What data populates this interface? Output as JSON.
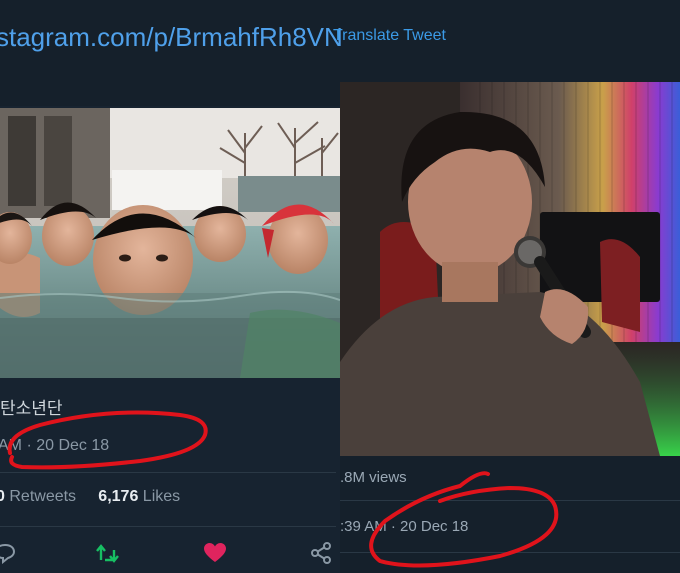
{
  "header": {
    "link_text": "stagram.com/p/BrmahfRh8VN",
    "translate_label": "Translate Tweet"
  },
  "left_tweet": {
    "caption": "탄소년단",
    "timestamp": "AM · 20 Dec 18",
    "retweets_count": "0",
    "retweets_label": "Retweets",
    "likes_count": "6,176",
    "likes_label": "Likes"
  },
  "right_tweet": {
    "views": ".8M views",
    "timestamp": ":39 AM · 20 Dec 18"
  },
  "icons": [
    "reply-icon",
    "retweet-icon",
    "like-icon",
    "share-icon"
  ],
  "colors": {
    "background": "#15202b",
    "link": "#4fa0ea",
    "annotation_red": "#e0131b",
    "retweet_active": "#17bf63",
    "like_active": "#e0245e"
  }
}
